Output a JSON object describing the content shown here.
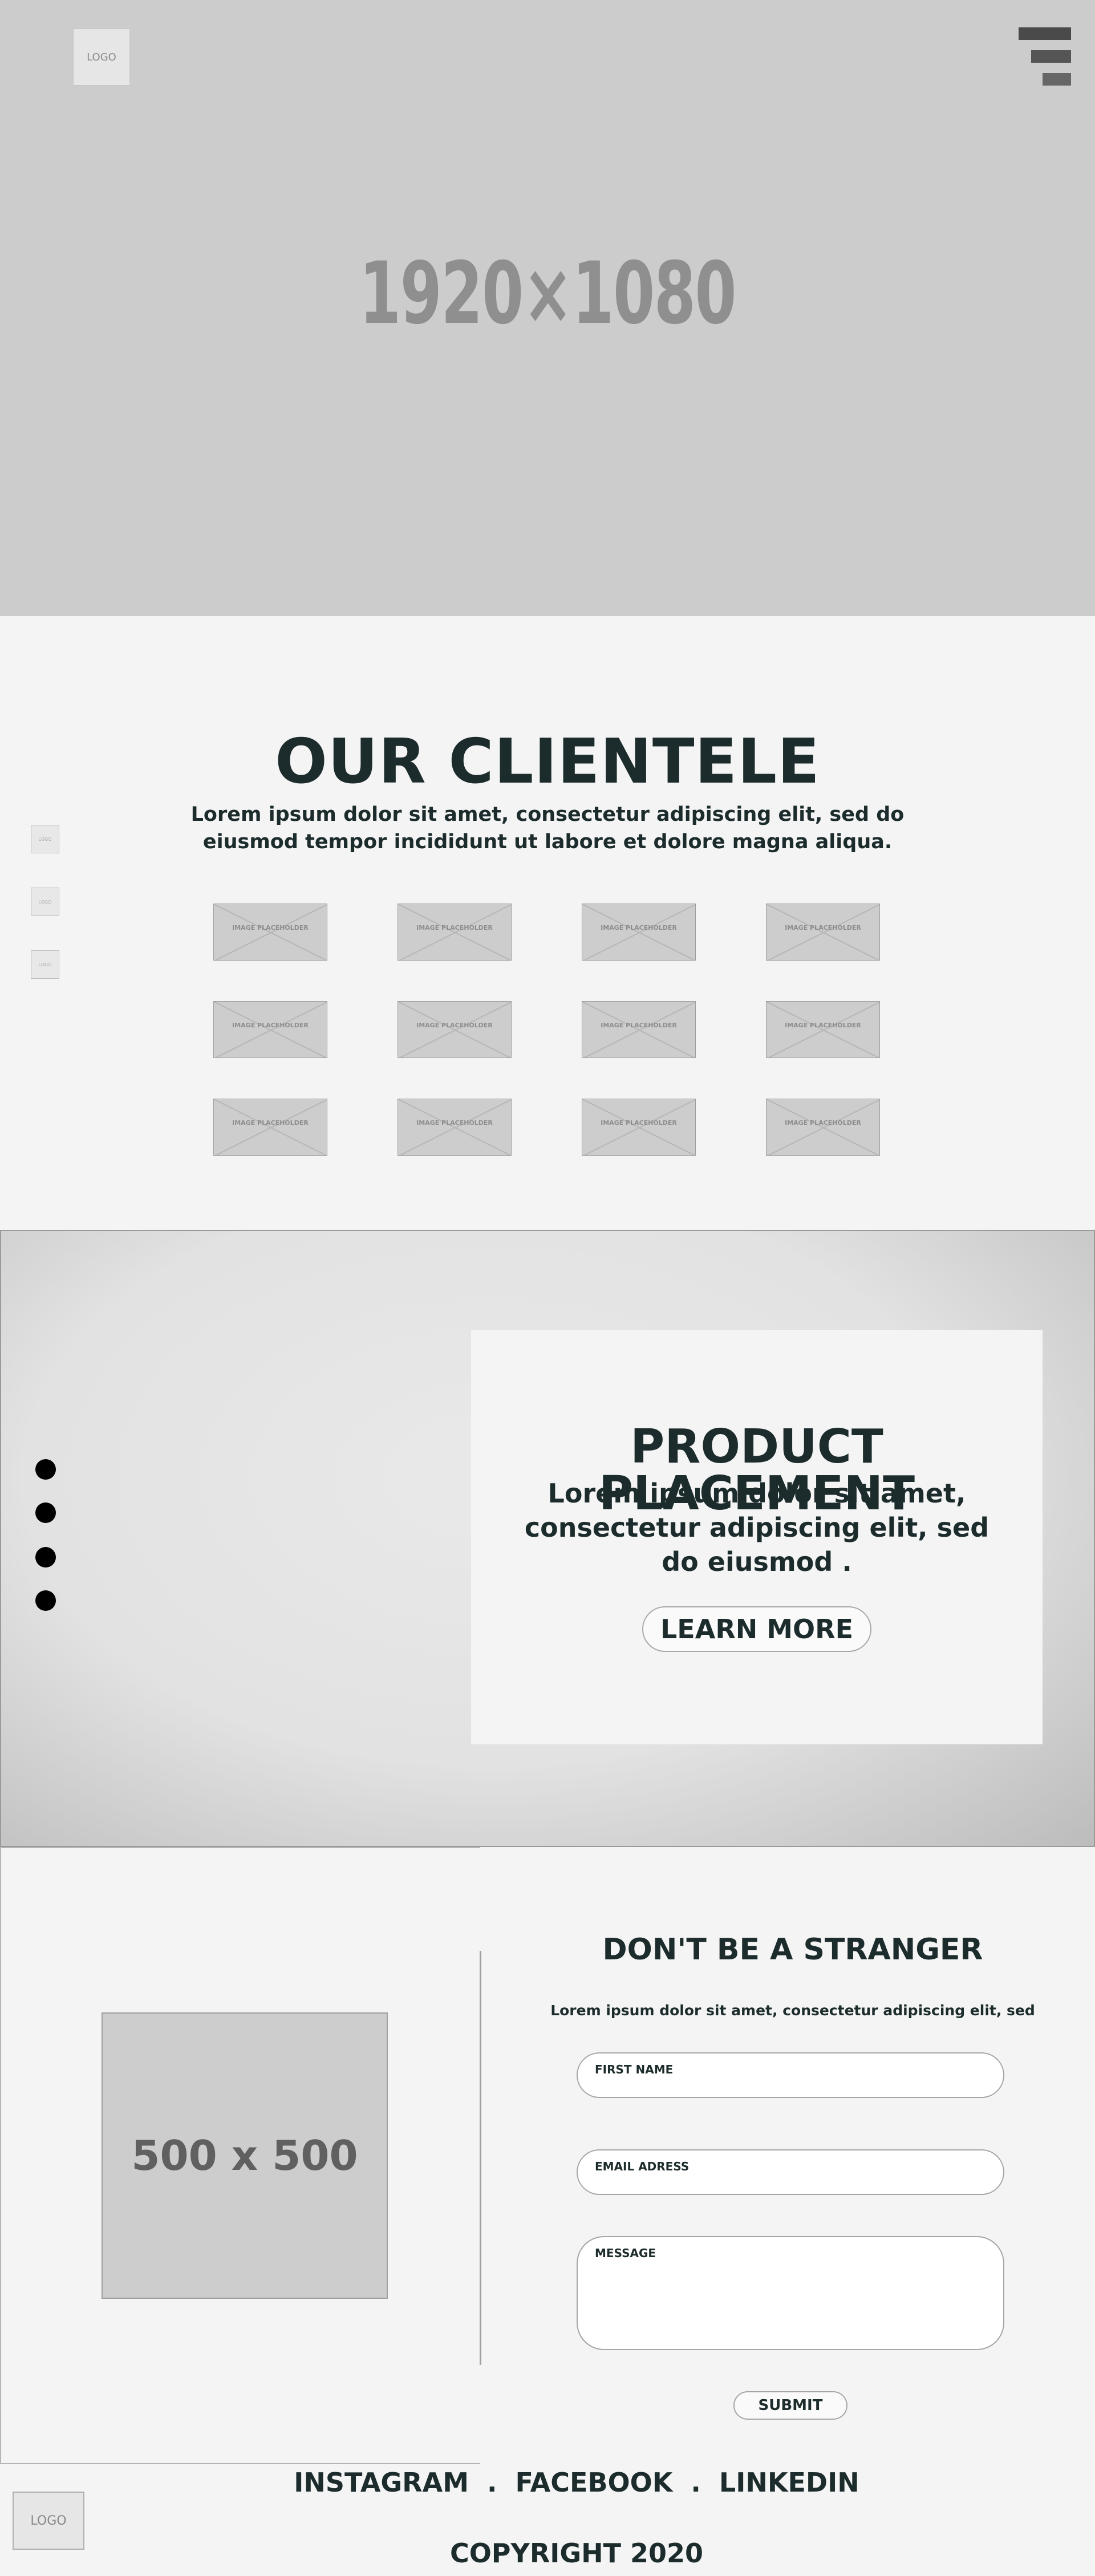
{
  "hero": {
    "logo": "LOGO",
    "dimensions": "1920×1080"
  },
  "clientele": {
    "title": "OUR CLIENTELE",
    "text": "Lorem ipsum dolor sit amet, consectetur adipiscing elit, sed do eiusmod tempor incididunt ut labore et dolore magna aliqua.",
    "side_logos": [
      "LOGO",
      "LOGO",
      "LOGO"
    ],
    "placeholder_label": "IMAGE PLACEHOLDER"
  },
  "product": {
    "title": "PRODUCT PLACEMENT",
    "text": "Lorem ipsum dolor sit amet, consectetur adipiscing elit, sed do eiusmod .",
    "button": "LEARN MORE"
  },
  "contact": {
    "photo": "500 x 500",
    "title": "DON'T BE A STRANGER",
    "text": "Lorem ipsum dolor sit amet, consectetur adipiscing elit, sed",
    "fields": {
      "first_name": "FIRST NAME",
      "email": "EMAIL ADRESS",
      "message": "MESSAGE"
    },
    "submit": "SUBMIT"
  },
  "footer": {
    "social": [
      "INSTAGRAM",
      "FACEBOOK",
      "LINKEDIN"
    ],
    "separator": ".",
    "logo": "LOGO",
    "copyright": "COPYRIGHT 2020"
  }
}
